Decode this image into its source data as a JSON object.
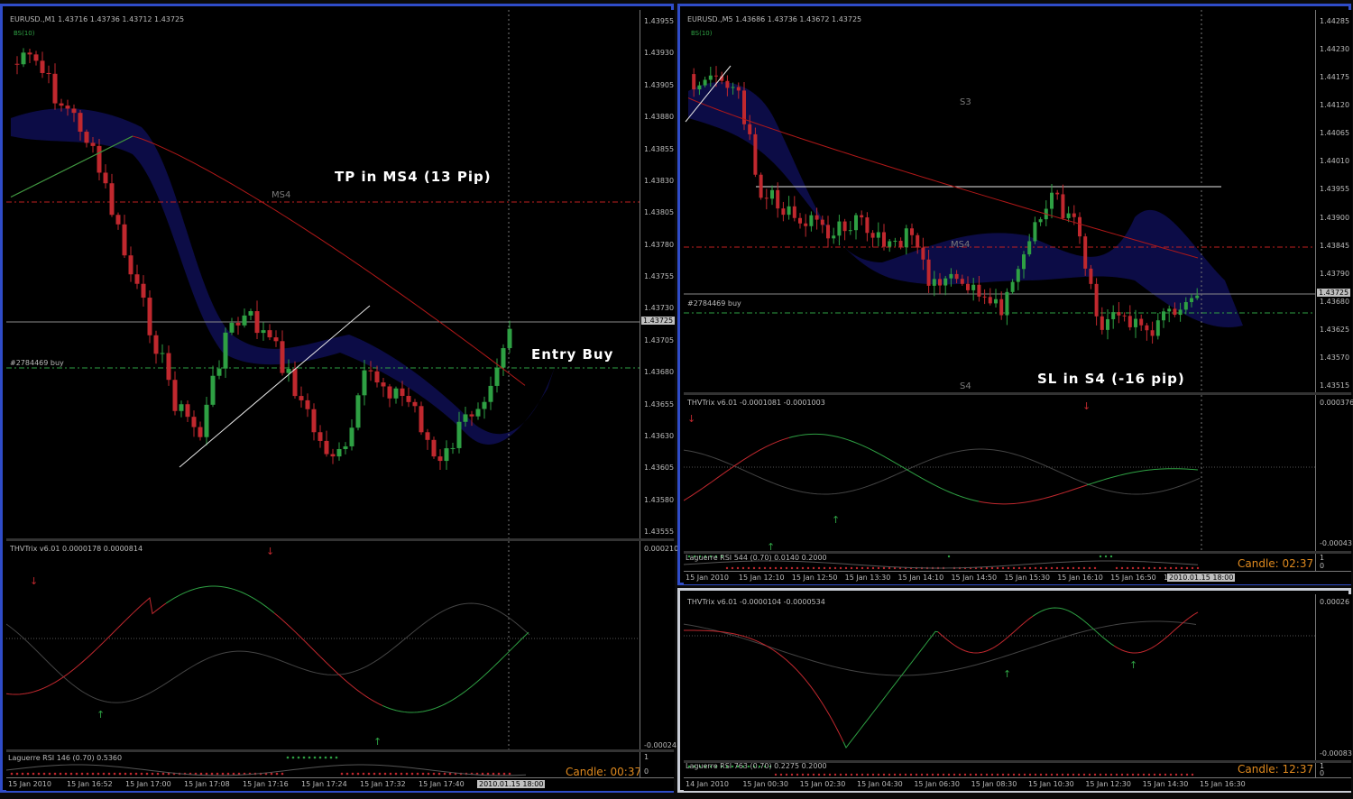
{
  "windows": [
    {
      "symbol_info": "EURUSD.,M1  1.43716 1.43736 1.43712 1.43725",
      "indicator_tag": "BS(10)",
      "annotations": {
        "tp": "TP in MS4 (13 Pip)",
        "entry": "Entry Buy"
      },
      "levels": {
        "ms4": "MS4",
        "order": "#2784469 buy"
      },
      "price_axis": [
        "1.43955",
        "1.43930",
        "1.43905",
        "1.43880",
        "1.43855",
        "1.43830",
        "1.43805",
        "1.43780",
        "1.43755",
        "1.43730",
        "1.43705",
        "1.43680",
        "1.43655",
        "1.43630",
        "1.43605",
        "1.43580",
        "1.43555"
      ],
      "current_price": "1.43725",
      "trix": {
        "label": "THVTrix v6.01 0.0000178 0.0000814",
        "axis_top": "0.000210",
        "axis_bottom": "-0.00024"
      },
      "laguerre": {
        "label": "Laguerre RSI 146 (0.70) 0.5360",
        "axis_top": "1",
        "axis_bottom": "0"
      },
      "candle_timer": "Candle: 00:37",
      "time_axis": [
        "15 Jan 2010",
        "15 Jan 16:52",
        "15 Jan 17:00",
        "15 Jan 17:08",
        "15 Jan 17:16",
        "15 Jan 17:24",
        "15 Jan 17:32",
        "15 Jan 17:40",
        "15 Jan 17:48"
      ],
      "time_highlight": "2010.01.15 18:00"
    },
    {
      "symbol_info": "EURUSD.,M5  1.43686 1.43736 1.43672 1.43725",
      "indicator_tag": "BS(10)",
      "annotations": {
        "sl": "SL in S4 (-16 pip)"
      },
      "levels": {
        "s3": "S3",
        "ms4": "MS4",
        "s4": "S4",
        "order": "#2784469 buy"
      },
      "price_axis": [
        "1.44285",
        "1.44230",
        "1.44175",
        "1.44120",
        "1.44065",
        "1.44010",
        "1.43955",
        "1.43900",
        "1.43845",
        "1.43790",
        "1.43680",
        "1.43625",
        "1.43570",
        "1.43515"
      ],
      "current_price": "1.43725",
      "trix": {
        "label": "THVTrix v6.01 -0.0001081 -0.0001003",
        "axis_top": "0.000376",
        "axis_bottom": "-0.00043"
      },
      "laguerre": {
        "label": "Laguerre RSI 544 (0.70) 0.0140 0.2000",
        "axis_top": "1",
        "axis_bottom": "0"
      },
      "candle_timer": "Candle: 02:37",
      "time_axis": [
        "15 Jan 2010",
        "15 Jan 12:10",
        "15 Jan 12:50",
        "15 Jan 13:30",
        "15 Jan 14:10",
        "15 Jan 14:50",
        "15 Jan 15:30",
        "15 Jan 16:10",
        "15 Jan 16:50",
        "15"
      ],
      "time_highlight": "2010.01.15 18:00"
    },
    {
      "trix": {
        "label": "THVTrix v6.01 -0.0000104 -0.0000534",
        "axis_top": "0.00026",
        "axis_bottom": "-0.00083"
      },
      "laguerre": {
        "label": "Laguerre RSI 763 (0.70) 0.2275 0.2000",
        "axis_top": "1",
        "axis_bottom": "0"
      },
      "candle_timer": "Candle: 12:37",
      "time_axis": [
        "14 Jan 2010",
        "15 Jan 00:30",
        "15 Jan 02:30",
        "15 Jan 04:30",
        "15 Jan 06:30",
        "15 Jan 08:30",
        "15 Jan 10:30",
        "15 Jan 12:30",
        "15 Jan 14:30",
        "15 Jan 16:30"
      ]
    }
  ],
  "colors": {
    "bull": "#2ea043",
    "bear": "#c0282e",
    "ma": "#b01818",
    "ichimoku": "#0d0d4a",
    "trend": "#e8e8e8",
    "level_red": "#c02020",
    "level_green": "#2ea043",
    "active_border": "#2f4cc8"
  }
}
